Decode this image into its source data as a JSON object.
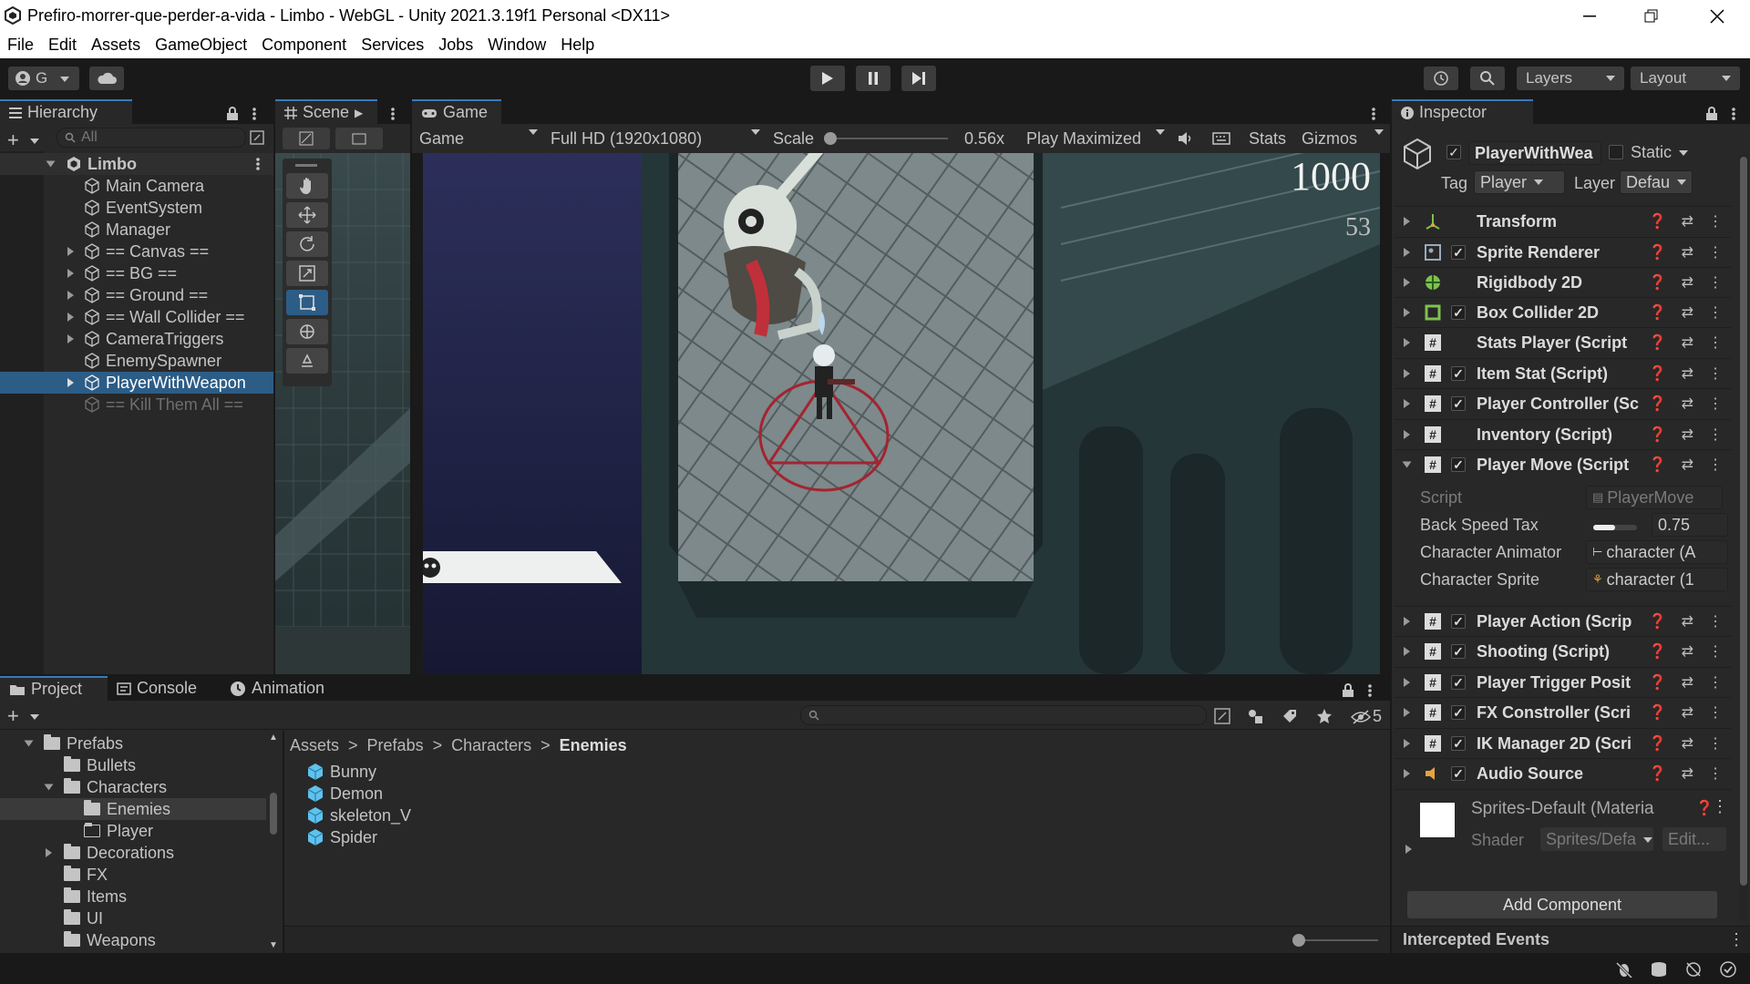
{
  "window": {
    "title": "Prefiro-morrer-que-perder-a-vida - Limbo - WebGL - Unity 2021.3.19f1 Personal <DX11>"
  },
  "menu": [
    "File",
    "Edit",
    "Assets",
    "GameObject",
    "Component",
    "Services",
    "Jobs",
    "Window",
    "Help"
  ],
  "toolbar": {
    "account": "G",
    "layers": "Layers",
    "layout": "Layout"
  },
  "hierarchy": {
    "tab": "Hierarchy",
    "search_placeholder": "All",
    "scene": "Limbo",
    "items": [
      "Main Camera",
      "EventSystem",
      "Manager",
      "== Canvas ==",
      "== BG ==",
      "== Ground ==",
      "== Wall Collider ==",
      "CameraTriggers",
      "EnemySpawner",
      "PlayerWithWeapon",
      "== Kill Them All =="
    ]
  },
  "scene": {
    "tab": "Scene"
  },
  "game": {
    "tab": "Game",
    "display": "Game",
    "resolution": "Full HD (1920x1080)",
    "scale_label": "Scale",
    "scale_value": "0.56x",
    "play_mode": "Play Maximized",
    "stats": "Stats",
    "gizmos": "Gizmos",
    "score": "1000",
    "timer": "53"
  },
  "inspector": {
    "tab": "Inspector",
    "object_name": "PlayerWithWea",
    "static_label": "Static",
    "tag_label": "Tag",
    "tag_value": "Player",
    "layer_label": "Layer",
    "layer_value": "Defau",
    "components": [
      {
        "name": "Transform",
        "icon": "transform-icon",
        "checkbox": false
      },
      {
        "name": "Sprite Renderer",
        "icon": "sprite-renderer-icon",
        "checkbox": true
      },
      {
        "name": "Rigidbody 2D",
        "icon": "rigidbody-icon",
        "checkbox": false
      },
      {
        "name": "Box Collider 2D",
        "icon": "box-collider-icon",
        "checkbox": true
      },
      {
        "name": "Stats Player (Script",
        "icon": "script-icon",
        "checkbox": false
      },
      {
        "name": "Item Stat (Script)",
        "icon": "script-icon",
        "checkbox": true
      },
      {
        "name": "Player Controller (Sc",
        "icon": "script-icon",
        "checkbox": true
      },
      {
        "name": "Inventory (Script)",
        "icon": "script-icon",
        "checkbox": false
      },
      {
        "name": "Player Move (Script",
        "icon": "script-icon",
        "checkbox": true
      }
    ],
    "player_move_fields": {
      "script_label": "Script",
      "script_value": "PlayerMove",
      "back_speed_label": "Back Speed Tax",
      "back_speed_value": "0.75",
      "back_speed_fraction": 0.5,
      "animator_label": "Character Animator",
      "animator_value": "character (A",
      "sprite_label": "Character Sprite",
      "sprite_value": "character (1"
    },
    "components2": [
      {
        "name": "Player Action (Scrip",
        "icon": "script-icon",
        "checkbox": true
      },
      {
        "name": "Shooting (Script)",
        "icon": "script-icon",
        "checkbox": true
      },
      {
        "name": "Player Trigger Posit",
        "icon": "script-icon",
        "checkbox": true
      },
      {
        "name": "FX Constroller (Scri",
        "icon": "script-icon",
        "checkbox": true
      },
      {
        "name": "IK Manager 2D (Scri",
        "icon": "script-icon",
        "checkbox": true
      },
      {
        "name": "Audio Source",
        "icon": "audio-source-icon",
        "checkbox": true
      }
    ],
    "material_name": "Sprites-Default (Materia",
    "shader_label": "Shader",
    "shader_value": "Sprites/Defa",
    "edit_label": "Edit...",
    "add_component": "Add Component",
    "intercepted": "Intercepted Events"
  },
  "bottom": {
    "tabs": [
      "Project",
      "Console",
      "Animation"
    ],
    "hidden_count": "5",
    "breadcrumb": [
      "Assets",
      "Prefabs",
      "Characters",
      "Enemies"
    ],
    "tree": [
      "Prefabs",
      "Bullets",
      "Characters",
      "Enemies",
      "Player",
      "Decorations",
      "FX",
      "Items",
      "UI",
      "Weapons"
    ],
    "assets": [
      "Bunny",
      "Demon",
      "skeleton_V",
      "Spider"
    ]
  },
  "colors": {
    "accent": "#2c5d87",
    "tab_highlight": "#3a79bb",
    "bg": "#191919",
    "panel": "#282828"
  }
}
